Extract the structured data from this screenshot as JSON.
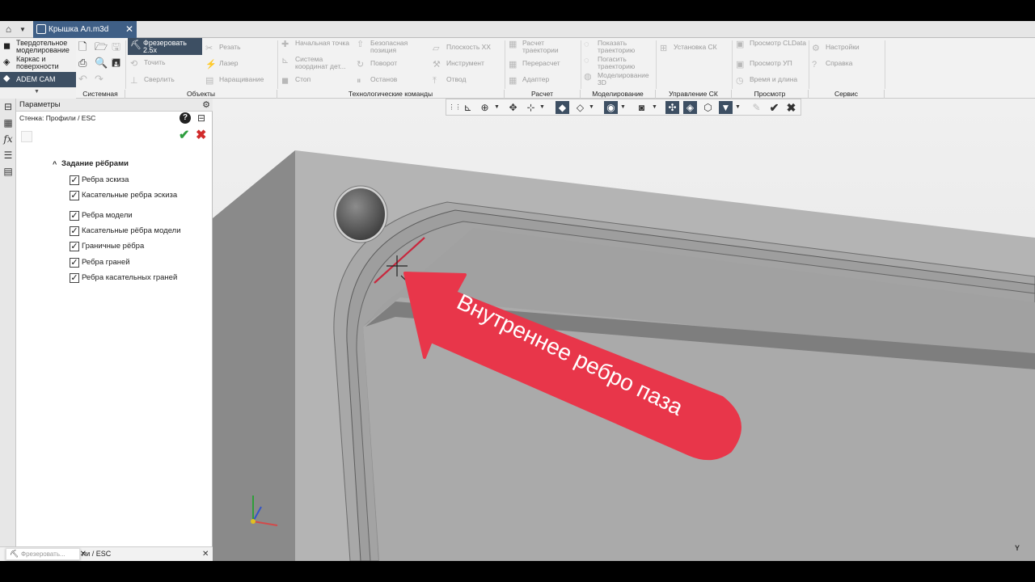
{
  "titlebar": {
    "doc_tab": "Крышка Ал.m3d",
    "close": "✕"
  },
  "ribbon": {
    "modes": [
      {
        "label": "Твердотельное моделирование",
        "icon": "solid-modeling-icon"
      },
      {
        "label": "Каркас и поверхности",
        "icon": "wireframe-surfaces-icon"
      },
      {
        "label": "ADEM CAM",
        "icon": "adem-cam-icon"
      }
    ],
    "milling": {
      "label": "Фрезеровать 2.5x",
      "icon": "milling-icon"
    },
    "groups": {
      "system": "Системная",
      "objects": "Объекты",
      "tech": "Технологические команды",
      "calc": "Расчет",
      "modeling": "Моделирование",
      "cs": "Управление СК",
      "view": "Просмотр",
      "service": "Сервис"
    },
    "buttons": {
      "cut": "Резать",
      "turn": "Точить",
      "drill": "Сверлить",
      "laser": "Лазер",
      "build": "Наращивание",
      "start_point": "Начальная точка",
      "cs_detail": "Система координат дет...",
      "stop": "Стоп",
      "safe_pos": "Безопасная позиция",
      "rotate": "Поворот",
      "halt": "Останов",
      "plane_xx": "Плоскость XX",
      "tool": "Инструмент",
      "retract": "Отвод",
      "calc_path": "Расчет траектории",
      "recalc": "Перерасчет",
      "adapter": "Адаптер",
      "show_path": "Показать траекторию",
      "hide_path": "Погасить траекторию",
      "model_3d": "Моделирование 3D",
      "set_cs": "Установка СК",
      "view_cldata": "Просмотр CLData",
      "view_up": "Просмотр УП",
      "time_len": "Время и длина",
      "settings": "Настройки",
      "help": "Справка"
    }
  },
  "panel": {
    "title": "Параметры",
    "subtitle": "Стенка: Профили / ESC",
    "section": "Задание рёбрами",
    "checkboxes": [
      {
        "label": "Ребра эскиза",
        "checked": true
      },
      {
        "label": "Касательные ребра эскиза",
        "checked": true
      },
      {
        "label": "Ребра модели",
        "checked": true
      },
      {
        "label": "Касательные рёбра модели",
        "checked": true
      },
      {
        "label": "Граничные рёбра",
        "checked": true
      },
      {
        "label": "Ребра граней",
        "checked": true
      },
      {
        "label": "Ребра касательных граней",
        "checked": true
      }
    ]
  },
  "bottom_tabs": {
    "tab1": "Фрезеровать...",
    "tab2": "ли / ESC"
  },
  "viewport": {
    "annotation": "Внутреннее ребро паза",
    "axis_label": "Y"
  },
  "colors": {
    "accent_dark": "#3d4f63",
    "doc_tab": "#3f5f86",
    "annotation_red": "#e8364a",
    "ok_green": "#2e9e3e",
    "cancel_red": "#d12b2b"
  }
}
